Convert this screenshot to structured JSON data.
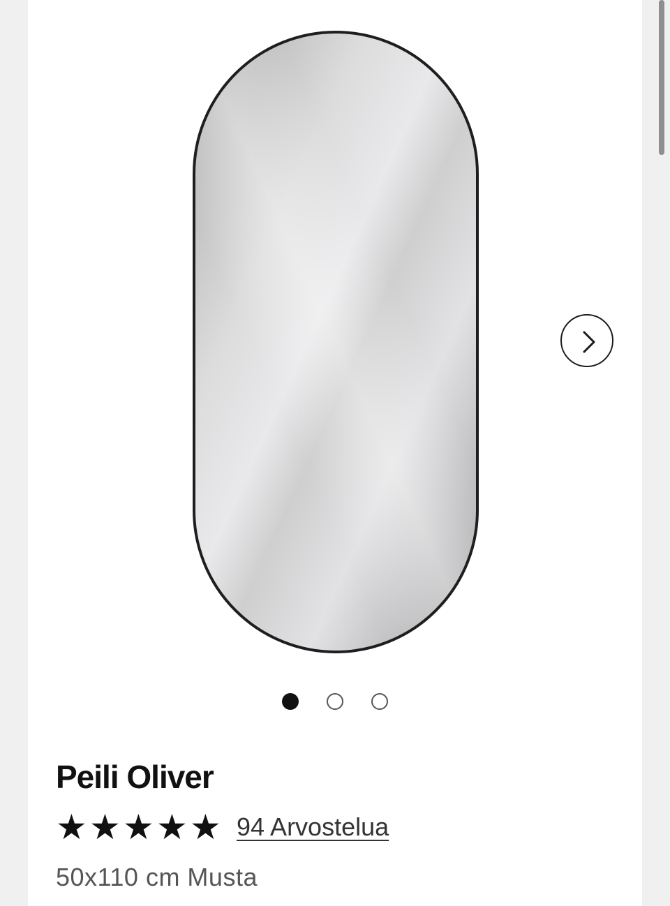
{
  "product": {
    "title": "Peili Oliver",
    "rating": 5,
    "rating_max": 5,
    "reviews_link": "94 Arvostelua",
    "variant": "50x110 cm Musta"
  },
  "gallery": {
    "image_name": "oval-mirror-image",
    "image_count": 3,
    "active_index": 0,
    "next_icon": "chevron-right-icon"
  },
  "colors": {
    "text_primary": "#111111",
    "text_secondary": "#555555",
    "frame": "#1e1e1e"
  }
}
